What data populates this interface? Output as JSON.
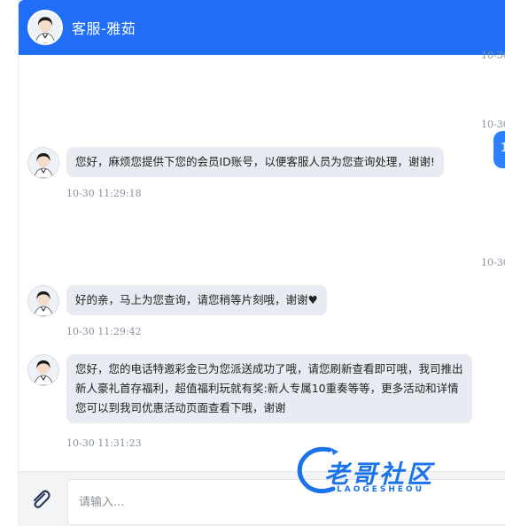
{
  "header": {
    "title": "客服-雅茹",
    "avatar_icon": "agent-avatar-icon"
  },
  "timestamps": {
    "top_partial": "10-30",
    "right_1": "10-30",
    "right_2": "10-30"
  },
  "user_bubble_partial": "1",
  "messages": [
    {
      "text_lines": [
        "您好，麻烦您提供下您的会员ID账号，以便客服人员为您查询处理，谢谢!"
      ],
      "time": "10-30 11:29:18"
    },
    {
      "text_lines": [
        "好的亲，马上为您查询，请您稍等片刻哦，谢谢♥"
      ],
      "time": "10-30 11:29:42"
    },
    {
      "text_lines": [
        "您好，您的电话特邀彩金已为您派送成功了哦，请您刷新查看即可哦，我司推出",
        "新人豪礼首存福利，超值福利玩就有奖:新人专属10重奏等等，更多活动和详情",
        "您可以到我司优惠活动页面查看下哦，谢谢"
      ],
      "time": "10-30 11:31:23"
    }
  ],
  "input": {
    "placeholder": "请输入..."
  },
  "watermark": {
    "text": "老哥社区",
    "sub": "LAOGESHEOU"
  },
  "colors": {
    "header": "#1f6ef5",
    "bubble_agent": "#e8ecf2",
    "bubble_user": "#2f80ff"
  }
}
